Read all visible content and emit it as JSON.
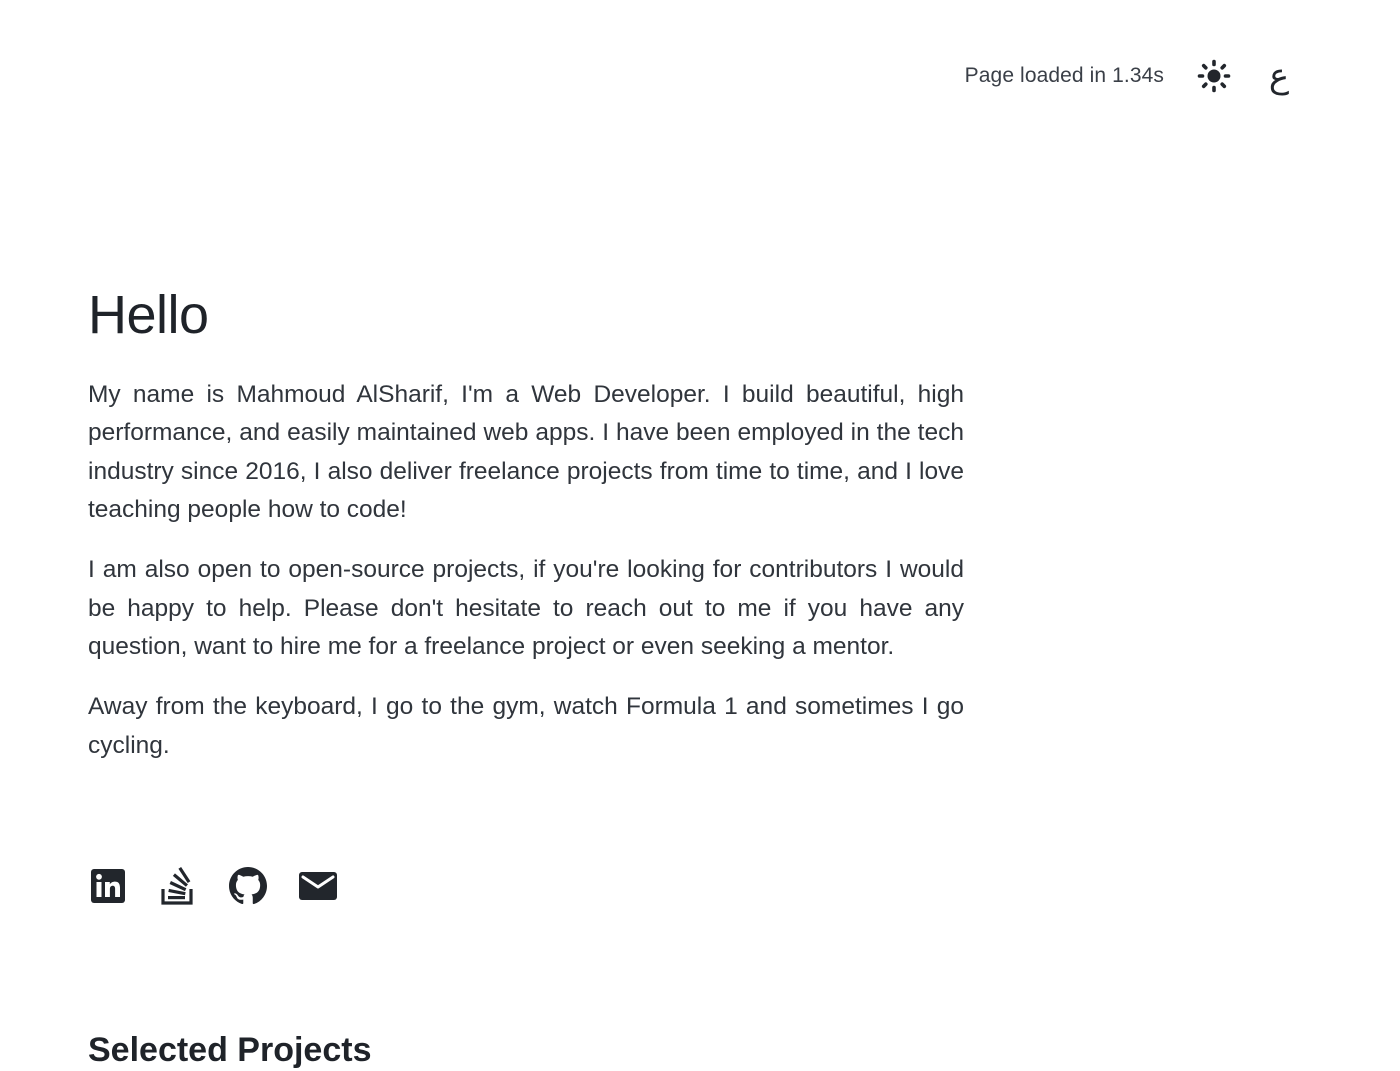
{
  "header": {
    "load_time_text": "Page loaded in 1.34s",
    "theme_icon": "sun-icon",
    "language_toggle_label": "ع"
  },
  "intro": {
    "heading": "Hello",
    "paragraphs": [
      "My name is Mahmoud AlSharif, I'm a Web Developer. I build beautiful, high performance, and easily maintained web apps. I have been employed in the tech industry since 2016, I also deliver freelance projects from time to time, and I love teaching people how to code!",
      "I am also open to open-source projects, if you're looking for contributors I would be happy to help. Please don't hesitate to reach out to me if you have any question, want to hire me for a freelance project or even seeking a mentor.",
      "Away from the keyboard, I go to the gym, watch Formula 1 and sometimes I go cycling."
    ]
  },
  "socials": [
    {
      "icon": "linkedin-icon"
    },
    {
      "icon": "stackoverflow-icon"
    },
    {
      "icon": "github-icon"
    },
    {
      "icon": "email-icon"
    }
  ],
  "projects": {
    "title": "Selected Projects"
  },
  "colors": {
    "text": "#30353c",
    "heading": "#1f2329",
    "icon": "#22262c",
    "background": "#ffffff"
  }
}
